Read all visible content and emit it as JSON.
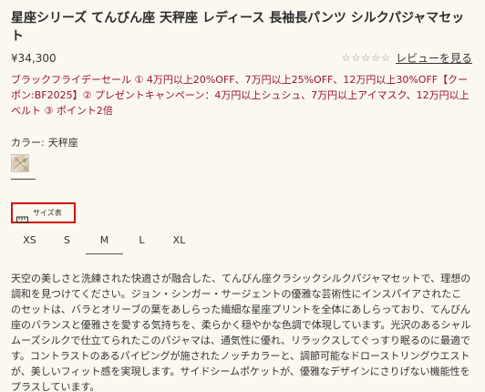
{
  "product": {
    "title": "星座シリーズ てんびん座 天秤座 レディース 長袖長パンツ シルクパジャマセット",
    "price": "¥34,300",
    "review_link": "レビューを見る",
    "stars": [
      "☆",
      "☆",
      "☆",
      "☆",
      "☆"
    ],
    "promo": "ブラックフライデーセール ① 4万円以上20%OFF、7万円以上25%OFF、12万円以上30%OFF【クーポン:BF2025】② プレゼントキャンペーン：4万円以上シュシュ、7万円以上アイマスク、12万円以上ベルト ③ ポイント2倍"
  },
  "color": {
    "label": "カラー:",
    "value": "天秤座",
    "swatch_icon": "floral-pattern-swatch"
  },
  "size_guide": {
    "label": "サイズ表",
    "icon": "ruler-icon",
    "highlight_color": "#d20f11"
  },
  "sizes": {
    "options": [
      "XS",
      "S",
      "M",
      "L",
      "XL"
    ],
    "selected": "M"
  },
  "description": "天空の美しさと洗練された快適さが融合した、てんびん座クラシックシルクパジャマセットで、理想の調和を見つけてください。ジョン・シンガー・サージェントの優雅な芸術性にインスパイアされたこのセットは、バラとオリーブの葉をあしらった繊細な星座プリントを全体にあしらっており、てんびん座のバランスと優雅さを愛する気持ちを、柔らかく穏やかな色調で体現しています。光沢のあるシャルムーズシルクで仕立てられたこのパジャマは、通気性に優れ、リラックスしてぐっすり眠るのに最適です。コントラストのあるパイピングが施されたノッチカラーと、調節可能なドローストリングウエストが、美しいフィット感を実現します。サイドシームポケットが、優雅なデザインにさりげない機能性をプラスしています。",
  "colors": {
    "background": "#fbf8ef",
    "promo_text": "#9a1237",
    "highlight_box": "#d20f11"
  }
}
